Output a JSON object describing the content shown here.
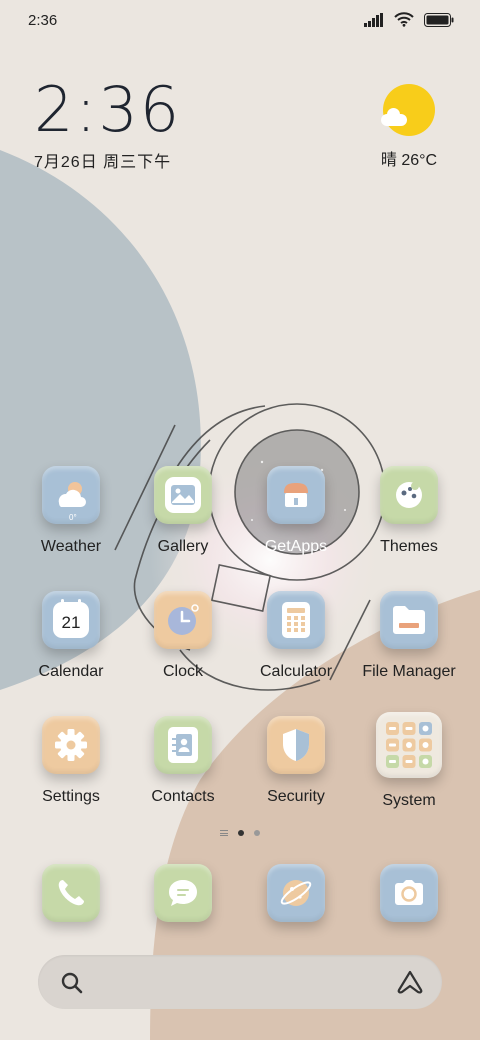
{
  "status_bar": {
    "time": "2:36",
    "icons": [
      "signal-icon",
      "wifi-icon",
      "battery-icon"
    ]
  },
  "clock_widget": {
    "time": "2:36",
    "date": "7月26日 周三下午"
  },
  "weather_widget": {
    "icon": "sun-cloud-icon",
    "text": "晴 26°C"
  },
  "apps": [
    {
      "label": "Weather",
      "icon": "weather-icon",
      "color": "#a8c0d6",
      "badge": "0°"
    },
    {
      "label": "Gallery",
      "icon": "gallery-icon",
      "color": "#c6d9a8"
    },
    {
      "label": "GetApps",
      "icon": "getapps-icon",
      "color": "#a8c0d6"
    },
    {
      "label": "Themes",
      "icon": "themes-icon",
      "color": "#c6d9a8"
    },
    {
      "label": "Calendar",
      "icon": "calendar-icon",
      "color": "#a8c0d6",
      "day": "21"
    },
    {
      "label": "Clock",
      "icon": "clock-icon",
      "color": "#eecaa0"
    },
    {
      "label": "Calculator",
      "icon": "calculator-icon",
      "color": "#a8c0d6"
    },
    {
      "label": "File Manager",
      "icon": "folder-icon",
      "color": "#a8c0d6"
    },
    {
      "label": "Settings",
      "icon": "gear-icon",
      "color": "#eecaa0"
    },
    {
      "label": "Contacts",
      "icon": "contacts-icon",
      "color": "#c6d9a8"
    },
    {
      "label": "Security",
      "icon": "shield-icon",
      "color": "#eecaa0"
    },
    {
      "label": "System",
      "icon": "folder-grid-icon",
      "color": "#efe9df"
    }
  ],
  "dock": [
    {
      "icon": "phone-icon",
      "color": "#c6d9a8"
    },
    {
      "icon": "message-icon",
      "color": "#c6d9a8"
    },
    {
      "icon": "browser-icon",
      "color": "#a8c0d6"
    },
    {
      "icon": "camera-icon",
      "color": "#a8c0d6"
    }
  ],
  "page_indicator": {
    "pages": 2,
    "current": 1
  },
  "search_bar": {
    "left_icon": "search-icon",
    "right_icon": "assistant-icon"
  }
}
